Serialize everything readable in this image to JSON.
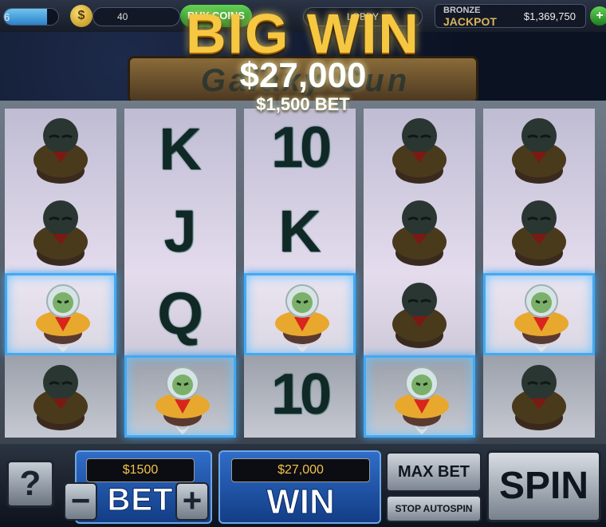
{
  "topbar": {
    "level_num": "6",
    "coin_icon": "coin-icon",
    "coins": "40",
    "buy_label": "BUY COINS",
    "lobby_label": "LOBBY",
    "jackpot_line1": "BRONZE",
    "jackpot_line2": "JACKPOT",
    "jackpot_value": "$1,369,750"
  },
  "logo_text": "Galaxy Gun",
  "big_win": {
    "title": "BIG WIN",
    "amount": "$27,000",
    "bet_line": "$1,500 BET"
  },
  "reels": [
    [
      "alien-sleeping",
      "alien-sleeping",
      "alien-astronaut",
      "alien-sleeping"
    ],
    [
      "K",
      "J",
      "Q",
      "alien-astronaut"
    ],
    [
      "10",
      "K",
      "alien-astronaut",
      "10"
    ],
    [
      "alien-sleeping",
      "alien-sleeping",
      "alien-sleeping",
      "alien-astronaut"
    ],
    [
      "alien-sleeping",
      "alien-sleeping",
      "alien-astronaut",
      "alien-sleeping"
    ]
  ],
  "controls": {
    "help_label": "?",
    "bet_value": "$1500",
    "bet_label": "BET",
    "minus_label": "−",
    "plus_label": "+",
    "win_value": "$27,000",
    "win_label": "WIN",
    "max_bet_label": "MAX BET",
    "stop_autospin_label": "STOP AUTOSPIN",
    "spin_label": "SPIN"
  },
  "colors": {
    "gold": "#f6c842",
    "highlight_blue": "#45a9f0",
    "panel_blue": "#2f6dc8"
  }
}
